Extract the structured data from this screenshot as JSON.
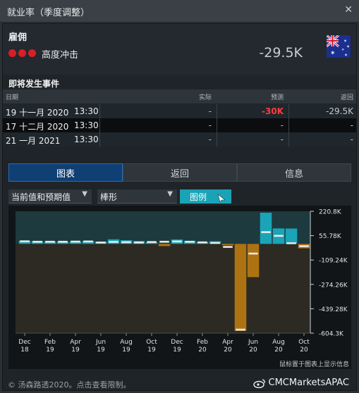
{
  "window": {
    "title": "就业率（季度调整）"
  },
  "event": {
    "name": "雇佣",
    "impact": "高度冲击",
    "value": "-29.5K",
    "flag_icon": "australia-flag-icon"
  },
  "upcoming": {
    "title": "即将发生事件",
    "columns": {
      "date": "日期",
      "actual": "实际",
      "forecast": "预测",
      "return": "返回"
    },
    "rows": [
      {
        "date": "19 十一月 2020",
        "time": "13:30",
        "actual": "-",
        "forecast": "-30K",
        "return": "-29.5K"
      },
      {
        "date": "17 十二月 2020",
        "time": "13:30",
        "actual": "-",
        "forecast": "-",
        "return": "-"
      },
      {
        "date": "21 一月 2021",
        "time": "13:30",
        "actual": "-",
        "forecast": "-",
        "return": "-"
      }
    ]
  },
  "tabs": [
    {
      "label": "图表"
    },
    {
      "label": "返回"
    },
    {
      "label": "信息"
    }
  ],
  "controls": {
    "series_select": "当前值和预期值",
    "type_select": "棒形",
    "legend_button": "图例"
  },
  "colors": {
    "positive": "#19a4b7",
    "negative": "#ad7312",
    "forecast_marker": "#e8e8e8",
    "forecast_text": "#ff3b3b"
  },
  "chart_data": {
    "type": "bar",
    "categories": [
      "Dec 18",
      "Jan 19",
      "Feb 19",
      "Mar 19",
      "Apr 19",
      "May 19",
      "Jun 19",
      "Jul 19",
      "Aug 19",
      "Sep 19",
      "Oct 19",
      "Nov 19",
      "Dec 19",
      "Jan 20",
      "Feb 20",
      "Mar 20",
      "Apr 20",
      "May 20",
      "Jun 20",
      "Jul 20",
      "Aug 20",
      "Sep 20",
      "Oct 20"
    ],
    "tick_labels": [
      {
        "month": "Dec",
        "year": "18"
      },
      {
        "month": "Feb",
        "year": "19"
      },
      {
        "month": "Apr",
        "year": "19"
      },
      {
        "month": "Jun",
        "year": "19"
      },
      {
        "month": "Aug",
        "year": "19"
      },
      {
        "month": "Oct",
        "year": "19"
      },
      {
        "month": "Dec",
        "year": "19"
      },
      {
        "month": "Feb",
        "year": "20"
      },
      {
        "month": "Apr",
        "year": "20"
      },
      {
        "month": "Jun",
        "year": "20"
      },
      {
        "month": "Aug",
        "year": "20"
      },
      {
        "month": "Oct",
        "year": "20"
      }
    ],
    "series": [
      {
        "values": [
          21,
          19,
          16,
          14,
          15,
          20,
          15,
          31,
          25,
          20,
          10,
          -15,
          30,
          21,
          12,
          18,
          -5,
          -590,
          -225,
          211,
          105,
          104,
          -30
        ]
      },
      {
        "values": [
          18,
          15,
          15,
          15,
          16,
          17,
          10,
          14,
          12,
          10,
          13,
          15,
          17,
          15,
          11,
          7,
          -20,
          -580,
          -65,
          80,
          55,
          5,
          -15
        ]
      }
    ],
    "y_ticks": [
      "220.8K",
      "55.78K",
      "-109.24K",
      "-274.26K",
      "-439.28K",
      "-604.3K"
    ],
    "ylim": [
      -604.3,
      220.8
    ],
    "hint": "鼠标置于图表上显示信息"
  },
  "footer": {
    "copyright": "© 汤森路透2020。点击查看限制。",
    "watermark": "CMCMarketsAPAC"
  }
}
